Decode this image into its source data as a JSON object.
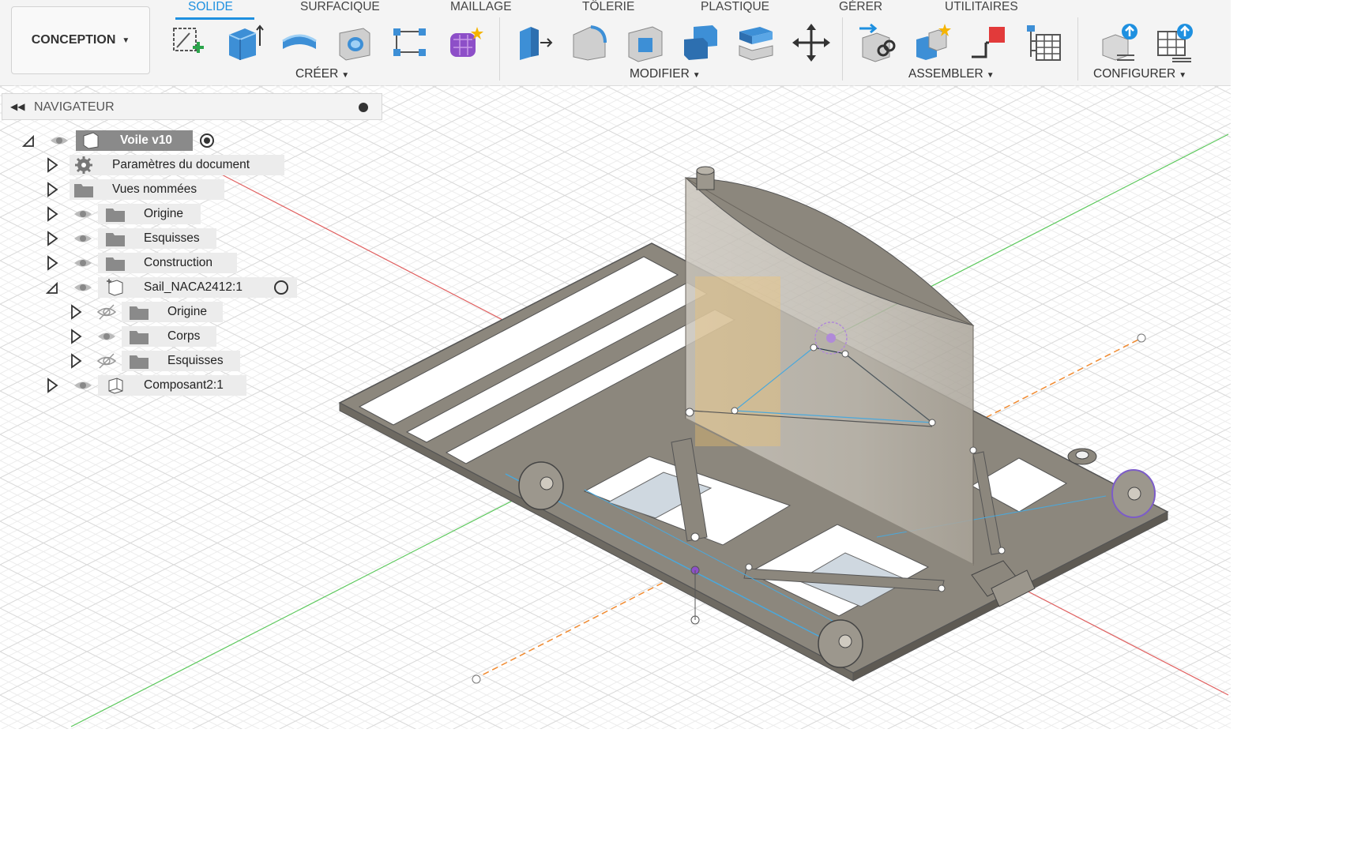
{
  "workspace": {
    "label": "CONCEPTION"
  },
  "tabs": [
    {
      "label": "SOLIDE",
      "active": true
    },
    {
      "label": "SURFACIQUE",
      "active": false
    },
    {
      "label": "MAILLAGE",
      "active": false
    },
    {
      "label": "TÔLERIE",
      "active": false
    },
    {
      "label": "PLASTIQUE",
      "active": false
    },
    {
      "label": "GÉRER",
      "active": false
    },
    {
      "label": "UTILITAIRES",
      "active": false
    }
  ],
  "groups": [
    {
      "label": "CRÉER"
    },
    {
      "label": "MODIFIER"
    },
    {
      "label": "ASSEMBLER"
    },
    {
      "label": "CONFIGURER"
    }
  ],
  "icons": {
    "creer": [
      "create-sketch-icon",
      "extrude-icon",
      "revolve-icon",
      "hole-icon",
      "pattern-icon",
      "form-icon"
    ],
    "modifier": [
      "press-pull-icon",
      "fillet-icon",
      "shell-icon",
      "combine-icon",
      "offset-face-icon",
      "move-icon"
    ],
    "assembler": [
      "joint-icon",
      "new-component-icon",
      "as-built-joint-icon",
      "joint-table-icon"
    ],
    "configurer": [
      "configure-icon",
      "configure-table-icon"
    ]
  },
  "navigator": {
    "title": "NAVIGATEUR",
    "root": {
      "label": "Voile v10"
    },
    "items": [
      {
        "label": "Paramètres du document"
      },
      {
        "label": "Vues nommées"
      },
      {
        "label": "Origine"
      },
      {
        "label": "Esquisses"
      },
      {
        "label": "Construction"
      },
      {
        "label": "Sail_NACA2412:1"
      },
      {
        "label": "Origine"
      },
      {
        "label": "Corps"
      },
      {
        "label": "Esquisses"
      },
      {
        "label": "Composant2:1"
      }
    ]
  },
  "colors": {
    "accent": "#1e90e0",
    "body": "#8c877d",
    "sail": "#bdb8ae",
    "sketch": "#4aa8dc",
    "axis_x": "#e06060",
    "axis_y": "#5cc85c",
    "axis_z": "#f08a30"
  }
}
